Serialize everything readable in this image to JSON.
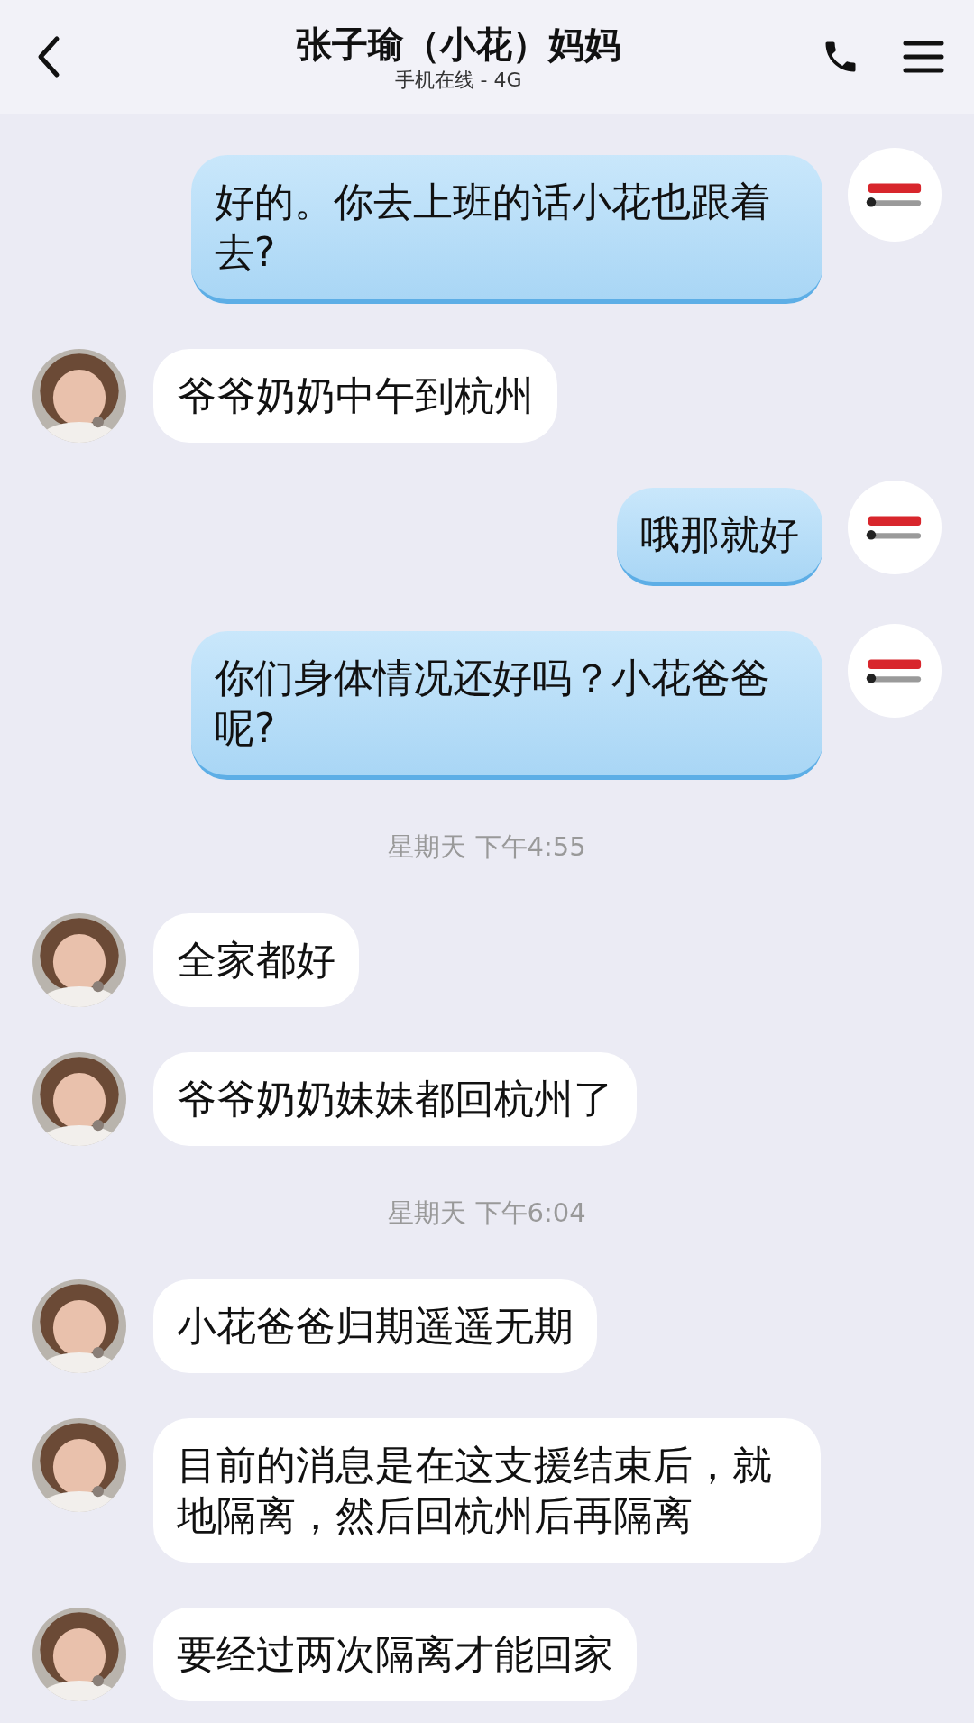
{
  "header": {
    "title": "张子瑜（小花）妈妈",
    "status": "手机在线 - 4G"
  },
  "messages": [
    {
      "kind": "outgoing",
      "text": "好的。你去上班的话小花也跟着去?"
    },
    {
      "kind": "incoming",
      "text": "爷爷奶奶中午到杭州"
    },
    {
      "kind": "outgoing",
      "text": "哦那就好"
    },
    {
      "kind": "outgoing",
      "text": "你们身体情况还好吗？小花爸爸呢?"
    },
    {
      "kind": "timestamp",
      "text": "星期天 下午4:55"
    },
    {
      "kind": "incoming",
      "text": "全家都好"
    },
    {
      "kind": "incoming",
      "text": "爷爷奶奶妹妹都回杭州了"
    },
    {
      "kind": "timestamp",
      "text": "星期天 下午6:04"
    },
    {
      "kind": "incoming",
      "text": "小花爸爸归期遥遥无期"
    },
    {
      "kind": "incoming",
      "text": "目前的消息是在这支援结束后，就地隔离，然后回杭州后再隔离"
    },
    {
      "kind": "incoming",
      "text": "要经过两次隔离才能回家"
    }
  ]
}
